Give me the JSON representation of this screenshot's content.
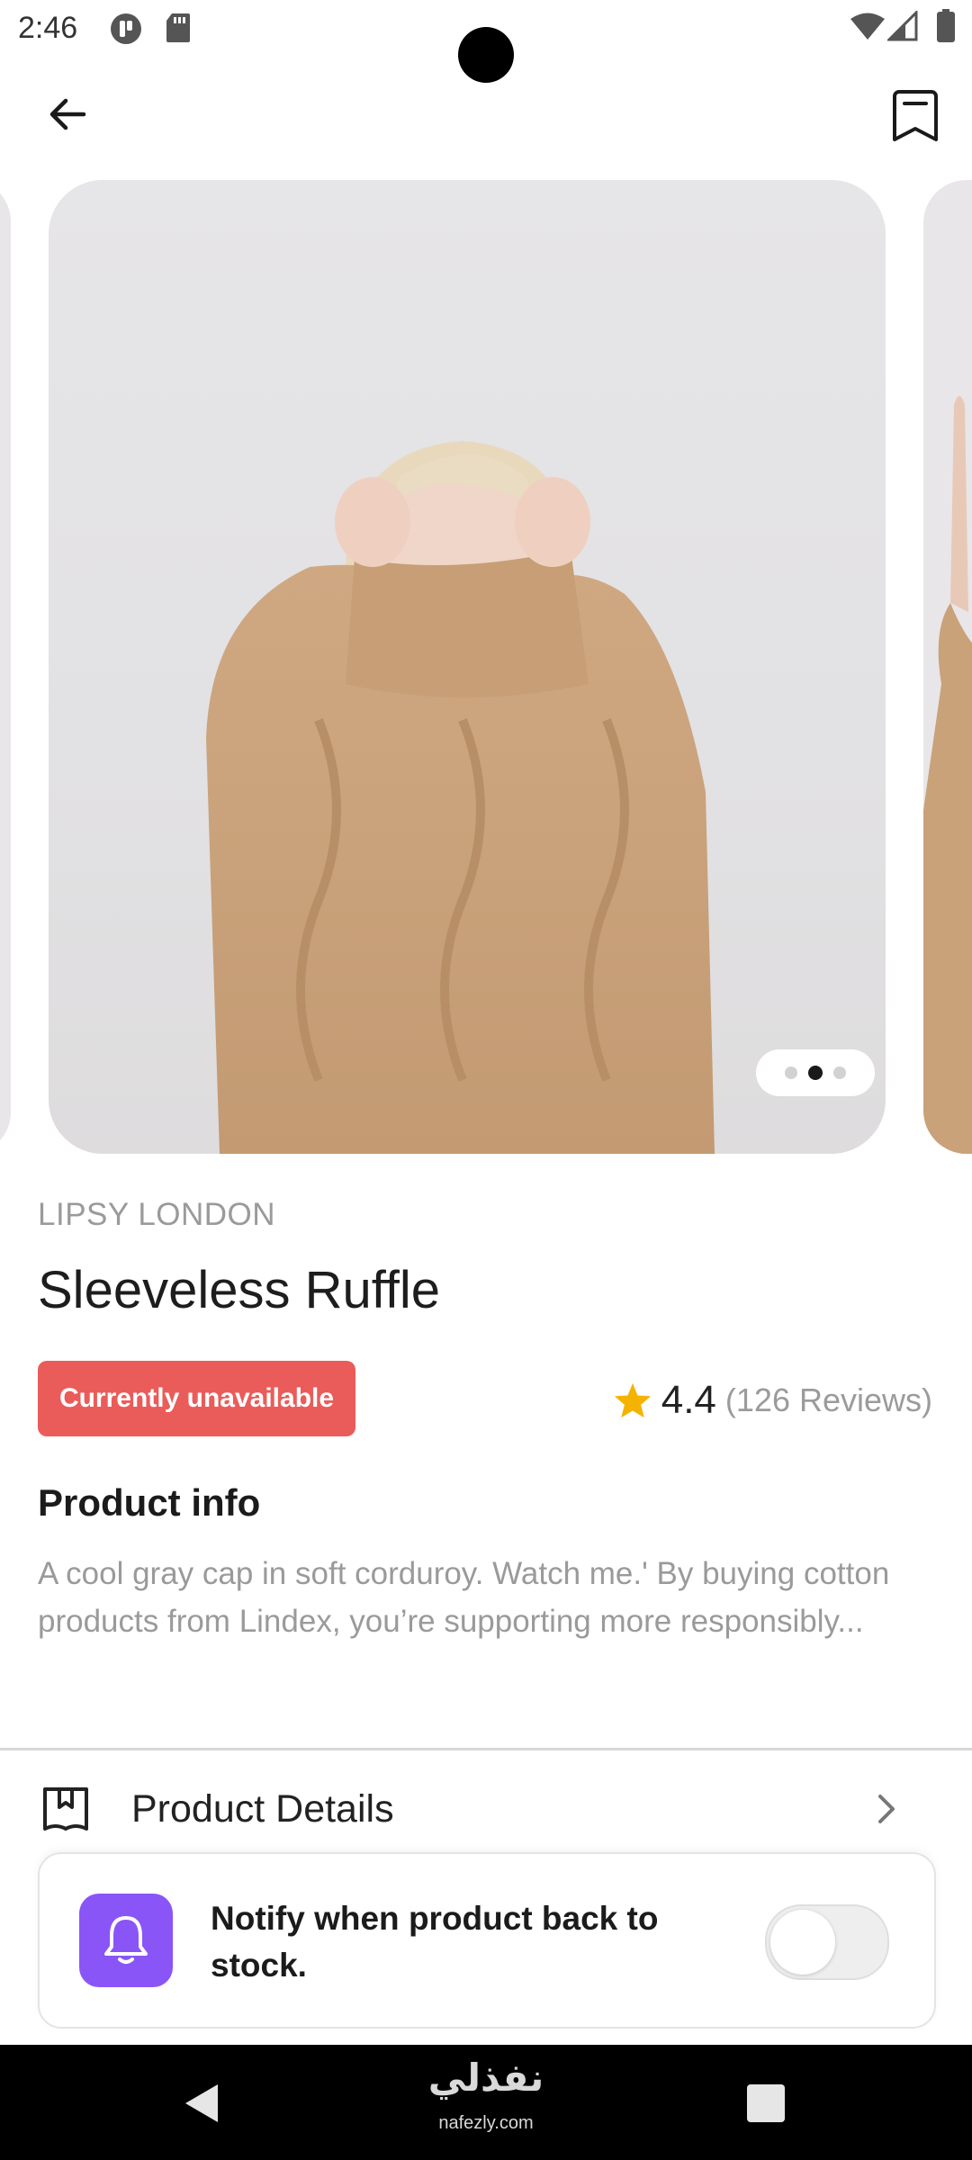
{
  "status_bar": {
    "time": "2:46",
    "left_icons": [
      "app-notification-icon",
      "sd-card-icon"
    ],
    "right_icons": [
      "wifi-icon",
      "signal-icon",
      "battery-icon"
    ]
  },
  "header": {
    "back_icon": "arrow-left-icon",
    "bookmark_icon": "bookmark-icon"
  },
  "carousel": {
    "image_description_icon": "product-photo",
    "page_count": 3,
    "active_index": 1
  },
  "product": {
    "brand": "LIPSY LONDON",
    "title": "Sleeveless Ruffle",
    "availability": "Currently unavailable",
    "rating": "4.4",
    "reviews": "(126 Reviews)",
    "info_heading": "Product info",
    "description": "A cool gray cap in soft corduroy. Watch me.' By buying cotton products from Lindex, you’re supporting more responsibly..."
  },
  "details": {
    "label": "Product Details"
  },
  "notify": {
    "text": "Notify when product back to stock.",
    "enabled": false
  },
  "watermark": {
    "arabic": "نفذلي",
    "url": "nafezly.com"
  },
  "colors": {
    "badge": "#ea5c5a",
    "bell_box": "#8a55f7",
    "star": "#f5b301",
    "sweater": "#c9a27a"
  }
}
